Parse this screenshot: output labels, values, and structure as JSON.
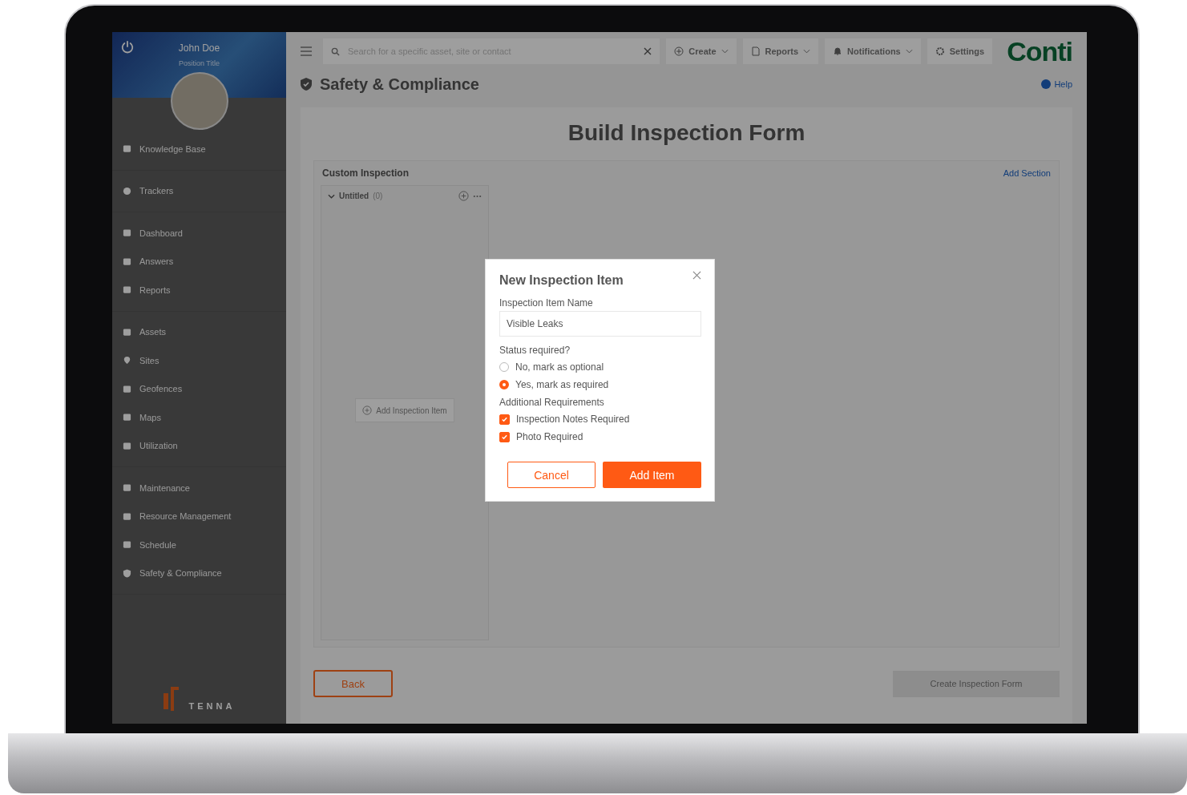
{
  "sidebar": {
    "user": {
      "name": "John Doe",
      "position": "Position Title"
    },
    "groups": [
      [
        {
          "label": "Knowledge Base"
        }
      ],
      [
        {
          "label": "Trackers"
        }
      ],
      [
        {
          "label": "Dashboard"
        },
        {
          "label": "Answers"
        },
        {
          "label": "Reports"
        }
      ],
      [
        {
          "label": "Assets"
        },
        {
          "label": "Sites"
        },
        {
          "label": "Geofences"
        },
        {
          "label": "Maps"
        },
        {
          "label": "Utilization"
        }
      ],
      [
        {
          "label": "Maintenance"
        },
        {
          "label": "Resource Management"
        },
        {
          "label": "Schedule"
        },
        {
          "label": "Safety & Compliance"
        }
      ]
    ],
    "brand": "TENNA"
  },
  "topbar": {
    "search": {
      "placeholder": "Search for a specific asset, site or contact"
    },
    "menus": [
      {
        "label": "Create",
        "kind": "create"
      },
      {
        "label": "Reports",
        "kind": "reports"
      },
      {
        "label": "Notifications",
        "kind": "notifications"
      },
      {
        "label": "Settings",
        "kind": "settings"
      }
    ],
    "logo": "Conti"
  },
  "page": {
    "title": "Safety & Compliance",
    "help": "Help"
  },
  "form": {
    "title": "Build Inspection Form",
    "section_title": "Custom Inspection",
    "add_section": "Add Section",
    "columns": [
      {
        "title": "Untitled",
        "count": "(0)",
        "add_item": "Add Inspection Item"
      }
    ],
    "back": "Back",
    "create": {
      "label": "Create Inspection Form",
      "disabled": true
    }
  },
  "modal": {
    "title": "New Inspection Item",
    "name_label": "Inspection Item Name",
    "name_value": "Visible Leaks",
    "status_label": "Status required?",
    "radios": [
      {
        "label": "No, mark as optional",
        "selected": false
      },
      {
        "label": "Yes, mark as required",
        "selected": true
      }
    ],
    "additional_label": "Additional Requirements",
    "checkboxes": [
      {
        "label": "Inspection Notes Required",
        "checked": true
      },
      {
        "label": "Photo Required",
        "checked": true
      }
    ],
    "cancel": "Cancel",
    "submit": "Add Item"
  }
}
